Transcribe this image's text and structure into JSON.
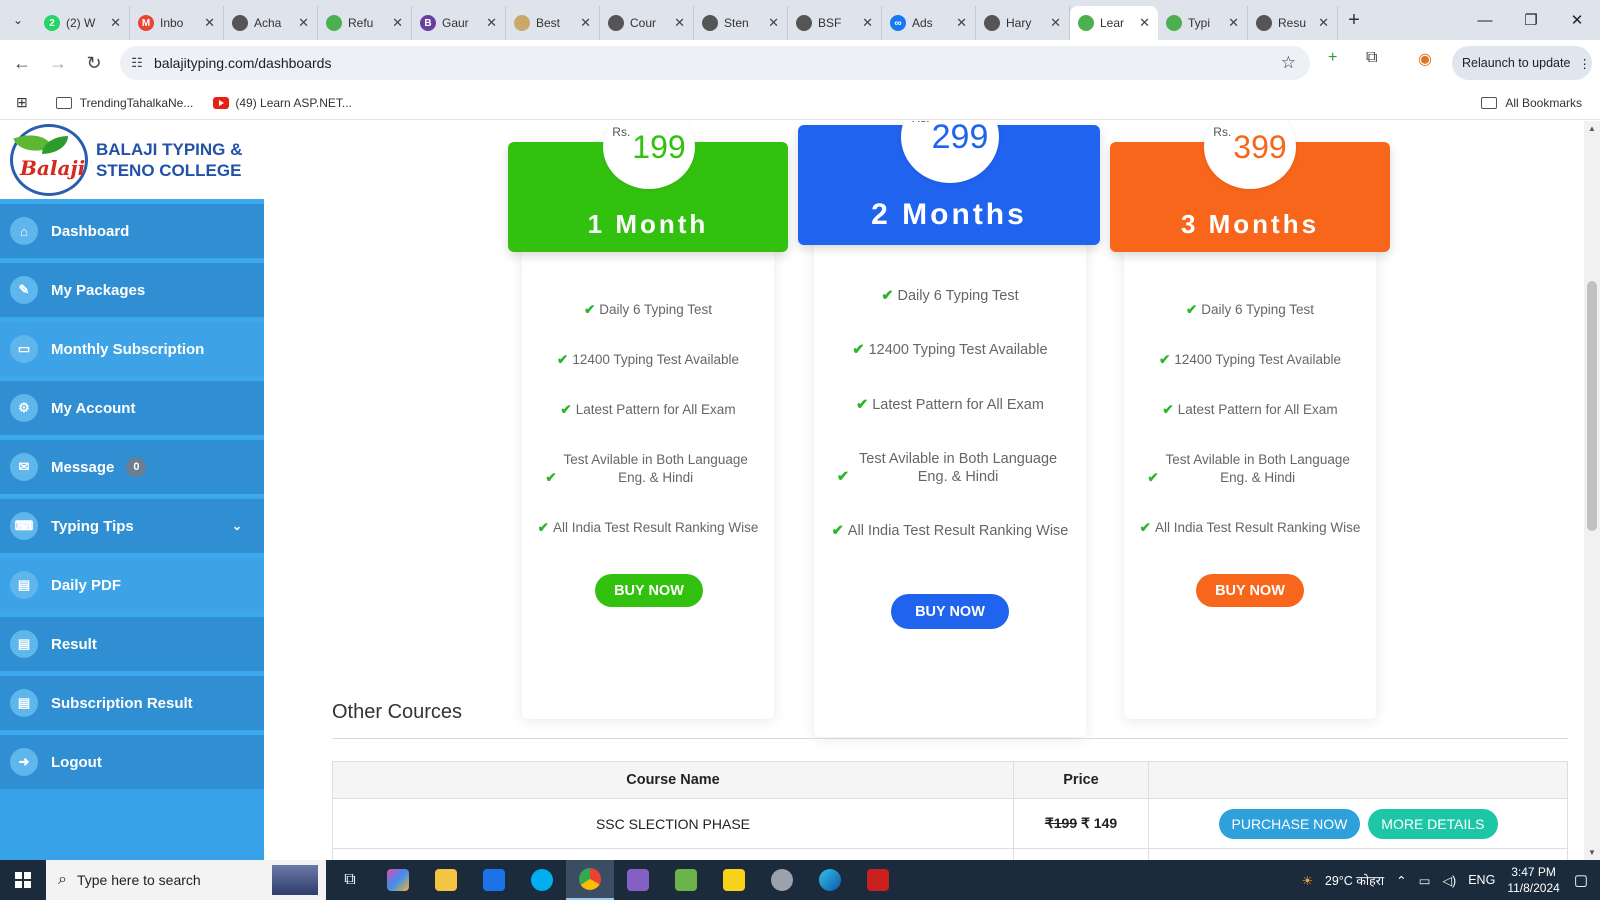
{
  "browser": {
    "tabs": [
      {
        "label": "(2) W",
        "color": "#25d366",
        "glyph": "2"
      },
      {
        "label": "Inbo",
        "color": "#ea4335",
        "glyph": "M"
      },
      {
        "label": "Acha",
        "color": "#555555",
        "glyph": ""
      },
      {
        "label": "Refu",
        "color": "#4caf50",
        "glyph": ""
      },
      {
        "label": "Gaur",
        "color": "#6a3fa0",
        "glyph": "B"
      },
      {
        "label": "Best",
        "color": "#c9a86a",
        "glyph": ""
      },
      {
        "label": "Cour",
        "color": "#555555",
        "glyph": ""
      },
      {
        "label": "Sten",
        "color": "#555555",
        "glyph": ""
      },
      {
        "label": "BSF",
        "color": "#555555",
        "glyph": ""
      },
      {
        "label": "Ads",
        "color": "#1877f2",
        "glyph": "∞"
      },
      {
        "label": "Hary",
        "color": "#555555",
        "glyph": ""
      },
      {
        "label": "Lear",
        "color": "#4caf50",
        "glyph": ""
      },
      {
        "label": "Typi",
        "color": "#4caf50",
        "glyph": ""
      },
      {
        "label": "Resu",
        "color": "#555555",
        "glyph": ""
      }
    ],
    "active_tab_index": 11,
    "url": "balajityping.com/dashboards",
    "relaunch_label": "Relaunch to update",
    "bookmarks": [
      {
        "label": "TrendingTahalkaNe...",
        "icon": "folder-icon"
      },
      {
        "label": "(49) Learn ASP.NET...",
        "icon": "youtube-icon"
      }
    ],
    "all_bookmarks_label": "All Bookmarks"
  },
  "brand": {
    "logo_text": "Balaji",
    "line1": "BALAJI TYPING &",
    "line2": "STENO COLLEGE"
  },
  "menu": [
    {
      "label": "Dashboard",
      "icon": "home-icon",
      "glyph": "⌂",
      "name": "dashboard"
    },
    {
      "label": "My Packages",
      "icon": "edit-icon",
      "glyph": "✎",
      "name": "my-packages"
    },
    {
      "label": "Monthly Subscription",
      "icon": "card-icon",
      "glyph": "▭",
      "name": "monthly-subscription",
      "active": true
    },
    {
      "label": "My Account",
      "icon": "gear-icon",
      "glyph": "⚙",
      "name": "my-account"
    },
    {
      "label": "Message",
      "icon": "envelope-icon",
      "glyph": "✉",
      "name": "message",
      "badge": "0"
    },
    {
      "label": "Typing Tips",
      "icon": "keyboard-icon",
      "glyph": "⌨",
      "name": "typing-tips",
      "chevron": "⌄"
    },
    {
      "label": "Daily PDF",
      "icon": "pdf-icon",
      "glyph": "▤",
      "name": "daily-pdf",
      "active": true
    },
    {
      "label": "Result",
      "icon": "document-icon",
      "glyph": "▤",
      "name": "result"
    },
    {
      "label": "Subscription Result",
      "icon": "document-icon",
      "glyph": "▤",
      "name": "subscription-result"
    },
    {
      "label": "Logout",
      "icon": "logout-icon",
      "glyph": "➜",
      "name": "logout"
    }
  ],
  "plans": [
    {
      "currency": "Rs.",
      "price": "199",
      "title": "1 Month",
      "color": "#33c10f",
      "features": [
        "Daily 6 Typing Test",
        "12400 Typing Test Available",
        "Latest Pattern for All Exam",
        "Test Avilable in Both Language Eng. & Hindi",
        "All India Test Result Ranking Wise"
      ],
      "button": "BUY NOW"
    },
    {
      "currency": "Rs.",
      "price": "299",
      "title": "2 Months",
      "color": "#1f63ee",
      "features": [
        "Daily 6 Typing Test",
        "12400 Typing Test Available",
        "Latest Pattern for All Exam",
        "Test Avilable in Both Language Eng. & Hindi",
        "All India Test Result Ranking Wise"
      ],
      "button": "BUY NOW"
    },
    {
      "currency": "Rs.",
      "price": "399",
      "title": "3 Months",
      "color": "#f7661a",
      "features": [
        "Daily 6 Typing Test",
        "12400 Typing Test Available",
        "Latest Pattern for All Exam",
        "Test Avilable in Both Language Eng. & Hindi",
        "All India Test Result Ranking Wise"
      ],
      "button": "BUY NOW"
    }
  ],
  "other_courses": {
    "title": "Other Cources",
    "columns": [
      "Course Name",
      "Price",
      ""
    ],
    "rows": [
      {
        "name": "SSC SLECTION PHASE",
        "old_price": "₹199",
        "new_price": "₹ 149",
        "purchase": "PURCHASE NOW",
        "details": "MORE DETAILS"
      }
    ]
  },
  "taskbar": {
    "search_placeholder": "Type here to search",
    "weather": "29°C कोहरा",
    "lang": "ENG",
    "time": "3:47 PM",
    "date": "11/8/2024"
  }
}
